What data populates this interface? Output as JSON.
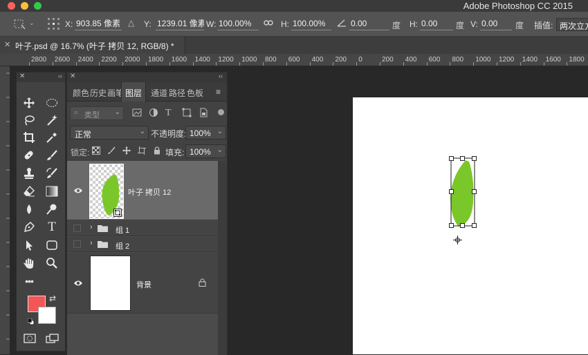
{
  "window": {
    "app_title": "Adobe Photoshop CC 2015",
    "traffic_lights": [
      "#fc605b",
      "#fdbc40",
      "#34c84a"
    ]
  },
  "options_bar": {
    "x_label": "X:",
    "x_value": "903.85 像素",
    "y_label": "Y:",
    "y_value": "1239.01 像素",
    "w_label": "W:",
    "w_value": "100.00%",
    "h_label": "H:",
    "h_value": "100.00%",
    "angle_value": "0.00",
    "angle_unit": "度",
    "skew_h_label": "H:",
    "skew_h_value": "0.00",
    "skew_h_unit": "度",
    "skew_v_label": "V:",
    "skew_v_value": "0.00",
    "skew_v_unit": "度",
    "interp_label": "插值:",
    "interp_value": "两次立方"
  },
  "document": {
    "tab_title": "叶子.psd @ 16.7% (叶子 拷贝 12, RGB/8) *",
    "canvas_color": "#ffffff",
    "leaf_color": "#7ac72a"
  },
  "ruler": {
    "labels": [
      "2800",
      "2600",
      "2400",
      "2200",
      "2000",
      "1800",
      "1600",
      "1400",
      "1200",
      "1000",
      "800",
      "600",
      "400",
      "200",
      "0",
      "200",
      "400",
      "600",
      "800",
      "1000",
      "1200",
      "1400",
      "1600",
      "1800"
    ]
  },
  "tools": {
    "foreground_color": "#f25656",
    "background_color": "#ffffff",
    "items": [
      "move-icon",
      "marquee-icon",
      "lasso-icon",
      "magic-wand-icon",
      "crop-icon",
      "eyedropper-icon",
      "healing-brush-icon",
      "brush-icon",
      "clone-stamp-icon",
      "history-brush-icon",
      "eraser-icon",
      "gradient-icon",
      "blur-icon",
      "dodge-icon",
      "pen-icon",
      "type-icon",
      "path-selection-icon",
      "rectangle-icon",
      "hand-icon",
      "zoom-icon",
      "more-tools-icon"
    ]
  },
  "layers_panel": {
    "tabs": [
      "颜色",
      "历史",
      "画笔",
      "图层",
      "通道",
      "路径",
      "色板"
    ],
    "active_tab": "图层",
    "kind_placeholder": "类型",
    "blend_mode": "正常",
    "opacity_label": "不透明度:",
    "opacity_value": "100%",
    "lock_label": "锁定:",
    "fill_label": "填充:",
    "fill_value": "100%",
    "layers": [
      {
        "name": "叶子 拷贝 12",
        "visible": true,
        "selected": true
      },
      {
        "name": "组 1",
        "visible": false,
        "type": "group"
      },
      {
        "name": "组 2",
        "visible": false,
        "type": "group"
      },
      {
        "name": "背景",
        "visible": true,
        "locked": true
      }
    ]
  }
}
